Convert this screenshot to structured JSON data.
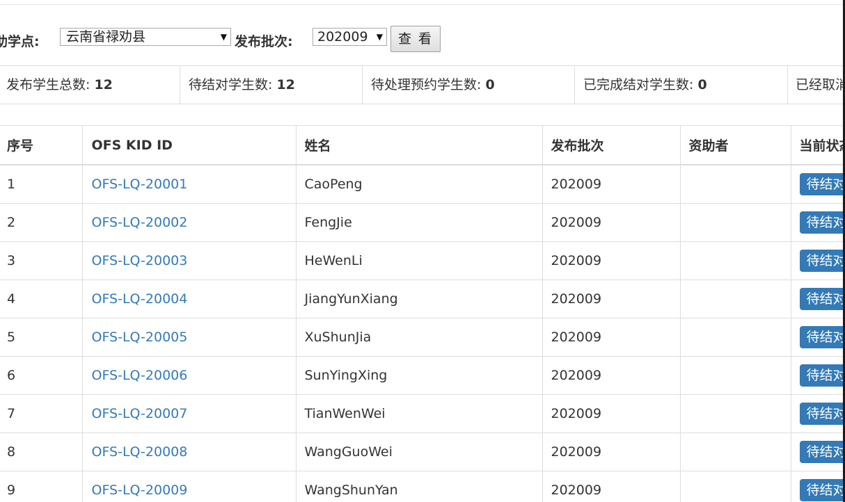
{
  "filter": {
    "site_label": "助学点:",
    "site_value": "云南省禄劝县",
    "batch_label": "发布批次:",
    "batch_value": "202009",
    "view_button": "查 看"
  },
  "stats": [
    {
      "label": "发布学生总数: ",
      "value": "12"
    },
    {
      "label": "待结对学生数: ",
      "value": "12"
    },
    {
      "label": "待处理预约学生数: ",
      "value": "0"
    },
    {
      "label": "已完成结对学生数: ",
      "value": "0"
    },
    {
      "label": "已经取消",
      "value": ""
    }
  ],
  "table": {
    "headers": [
      "序号",
      "OFS KID ID",
      "姓名",
      "发布批次",
      "资助者",
      "当前状态"
    ],
    "rows": [
      {
        "no": "1",
        "kid_id": "OFS-LQ-20001",
        "name": "CaoPeng",
        "batch": "202009",
        "sponsor": "",
        "status": "待结对"
      },
      {
        "no": "2",
        "kid_id": "OFS-LQ-20002",
        "name": "FengJie",
        "batch": "202009",
        "sponsor": "",
        "status": "待结对"
      },
      {
        "no": "3",
        "kid_id": "OFS-LQ-20003",
        "name": "HeWenLi",
        "batch": "202009",
        "sponsor": "",
        "status": "待结对"
      },
      {
        "no": "4",
        "kid_id": "OFS-LQ-20004",
        "name": "JiangYunXiang",
        "batch": "202009",
        "sponsor": "",
        "status": "待结对"
      },
      {
        "no": "5",
        "kid_id": "OFS-LQ-20005",
        "name": "XuShunJia",
        "batch": "202009",
        "sponsor": "",
        "status": "待结对"
      },
      {
        "no": "6",
        "kid_id": "OFS-LQ-20006",
        "name": "SunYingXing",
        "batch": "202009",
        "sponsor": "",
        "status": "待结对"
      },
      {
        "no": "7",
        "kid_id": "OFS-LQ-20007",
        "name": "TianWenWei",
        "batch": "202009",
        "sponsor": "",
        "status": "待结对"
      },
      {
        "no": "8",
        "kid_id": "OFS-LQ-20008",
        "name": "WangGuoWei",
        "batch": "202009",
        "sponsor": "",
        "status": "待结对"
      },
      {
        "no": "9",
        "kid_id": "OFS-LQ-20009",
        "name": "WangShunYan",
        "batch": "202009",
        "sponsor": "",
        "status": "待结对"
      }
    ]
  },
  "colors": {
    "link": "#337ab7",
    "badge": "#337ab7",
    "border": "#dddddd"
  }
}
